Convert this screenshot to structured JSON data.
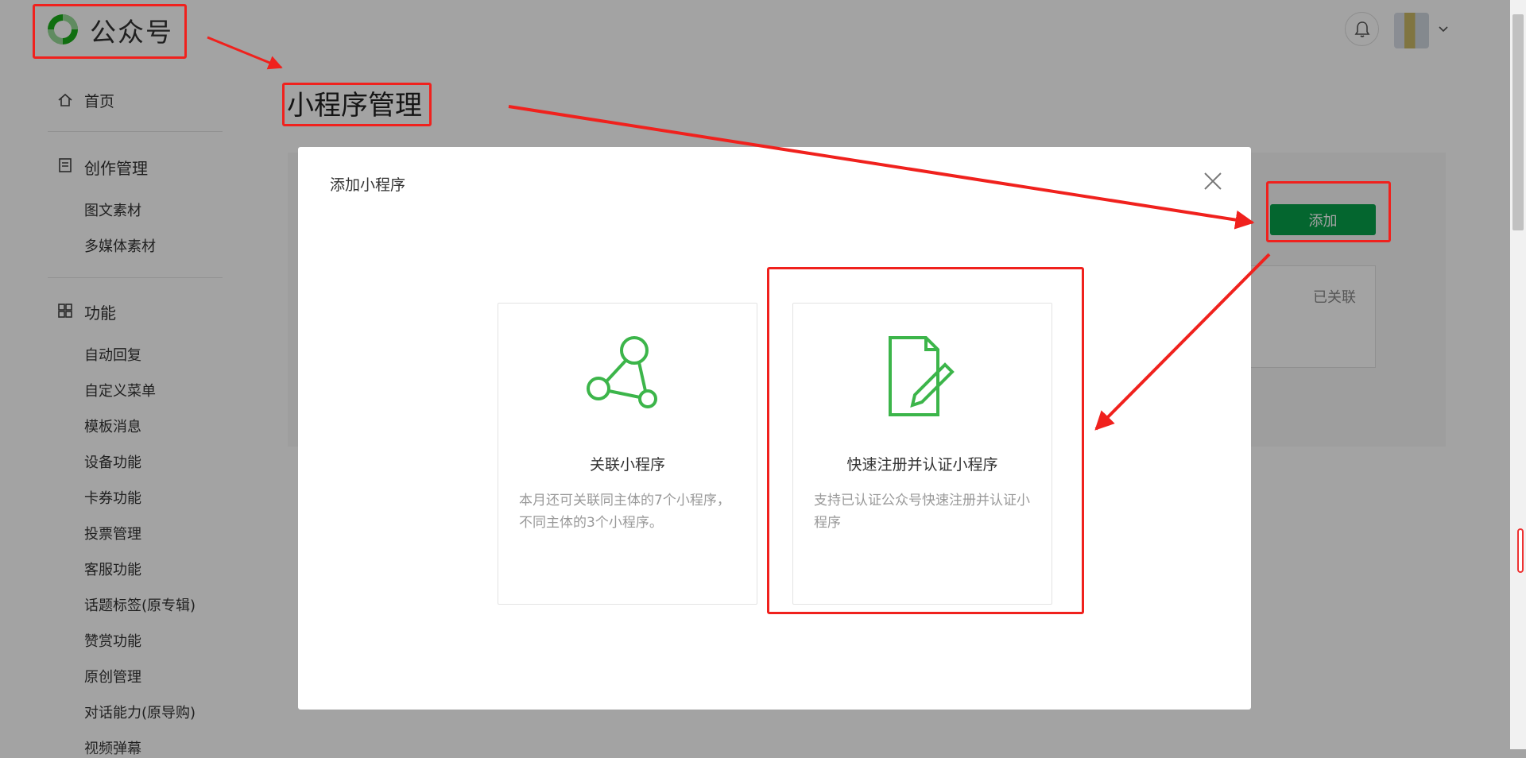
{
  "header": {
    "brand": "公众号",
    "logo_icon": "wechat-mp-logo",
    "bell_icon": "bell-icon",
    "avatar_icon": "user-avatar",
    "caret_icon": "chevron-down-icon"
  },
  "sidebar": {
    "home": "首页",
    "content_group": "创作管理",
    "content_items": [
      "图文素材",
      "多媒体素材"
    ],
    "features_group": "功能",
    "feature_items": [
      "自动回复",
      "自定义菜单",
      "模板消息",
      "设备功能",
      "卡券功能",
      "投票管理",
      "客服功能",
      "话题标签(原专辑)",
      "赞赏功能",
      "原创管理",
      "对话能力(原导购)",
      "视频弹幕"
    ]
  },
  "main": {
    "title": "小程序管理",
    "add_button": "添加",
    "linked_label": "已关联"
  },
  "modal": {
    "title": "添加小程序",
    "close_icon": "close-icon",
    "options": [
      {
        "icon": "link-network-icon",
        "title": "关联小程序",
        "desc": "本月还可关联同主体的7个小程序，不同主体的3个小程序。"
      },
      {
        "icon": "edit-document-icon",
        "title": "快速注册并认证小程序",
        "desc": "支持已认证公众号快速注册并认证小程序"
      }
    ]
  },
  "colors": {
    "accent_green": "#07a04a",
    "icon_green": "#3cb54a",
    "annotation_red": "#f0211d"
  }
}
